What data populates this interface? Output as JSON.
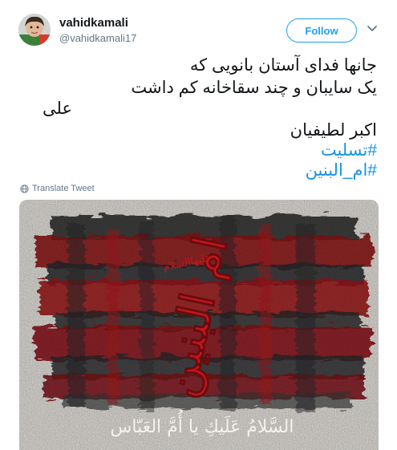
{
  "user": {
    "display_name": "vahidkamali",
    "handle": "@vahidkamali17"
  },
  "actions": {
    "follow_label": "Follow",
    "menu_icon": "chevron-down-icon"
  },
  "tweet": {
    "line1": "جانها فدای آستان بانویی که",
    "line2": "یک سایبان و چند سقاخانه کم داشت",
    "line3": "علی",
    "line4": "اکبر لطیفیان",
    "hashtags": [
      "#تسلیت",
      "#ام_البنین"
    ]
  },
  "translate": {
    "label": "Translate Tweet",
    "icon": "globe-icon"
  },
  "media": {
    "calligraphy_main": "ام البنین",
    "calligraphy_small": "علیهاالسلام",
    "caption": "السَّلامُ عَلَيكِ يا أُمَّ العَبّاس"
  },
  "colors": {
    "accent": "#1da1f2",
    "link": "#1b95e0",
    "muted": "#657786",
    "text": "#14171a",
    "art_red": "#9e1418",
    "art_dark": "#2a2a2c"
  }
}
